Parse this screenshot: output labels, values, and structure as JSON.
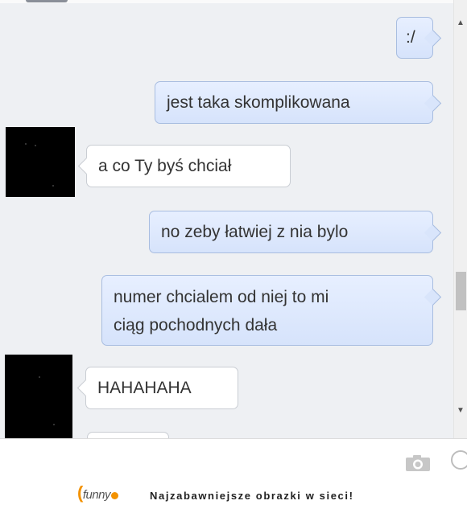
{
  "messages": [
    {
      "from": "me",
      "text": ":/"
    },
    {
      "from": "me",
      "text": "jest taka skomplikowana"
    },
    {
      "from": "them",
      "text": "a co Ty byś chciał"
    },
    {
      "from": "me",
      "text": "no zeby łatwiej z nia bylo"
    },
    {
      "from": "me",
      "lines": [
        "numer chcialem od niej to mi",
        "ciąg pochodnych dała"
      ]
    },
    {
      "from": "them",
      "text": "HAHAHAHA"
    }
  ],
  "composer": {
    "camera_icon": "camera-icon",
    "emoji_icon": "smiley-icon"
  },
  "footer": {
    "logo_text": "funny",
    "tagline": "Najzabawniejsze obrazki w sieci!"
  },
  "colors": {
    "outgoing_bubble": "#dce7fc",
    "incoming_bubble": "#ffffff",
    "chat_background": "#eef0f3",
    "logo_accent": "#f39200"
  }
}
